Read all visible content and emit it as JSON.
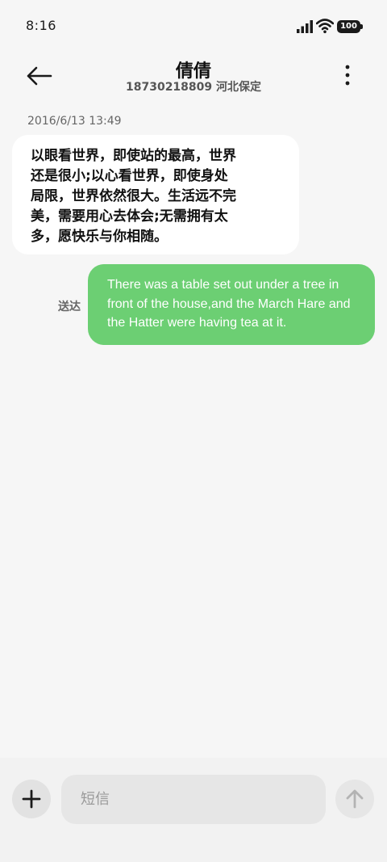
{
  "status_bar": {
    "time": "8:16",
    "battery": "100"
  },
  "header": {
    "contact_name": "倩倩",
    "contact_subtitle": "18730218809 河北保定"
  },
  "messages": [
    {
      "direction": "incoming",
      "timestamp": "2016/6/13 13:49",
      "text": "以眼看世界，即使站的最高，世界\n还是很小;以心看世界，即使身处\n局限，世界依然很大。生活远不完\n美，需要用心去体会;无需拥有太\n多，愿快乐与你相随。"
    },
    {
      "direction": "outgoing",
      "status": "送达",
      "text": "There was a table set out under a tree in front of the house,and the March Hare and the Hatter were having tea at it."
    }
  ],
  "composer": {
    "placeholder": "短信"
  },
  "colors": {
    "outgoing_bubble": "#6ccf73",
    "incoming_bubble": "#ffffff",
    "background": "#f6f6f6"
  },
  "icons": {
    "back": "arrow-left-icon",
    "more": "more-vertical-icon",
    "add": "plus-icon",
    "send": "arrow-up-icon",
    "signal": "signal-icon",
    "wifi": "wifi-icon",
    "battery": "battery-icon"
  }
}
